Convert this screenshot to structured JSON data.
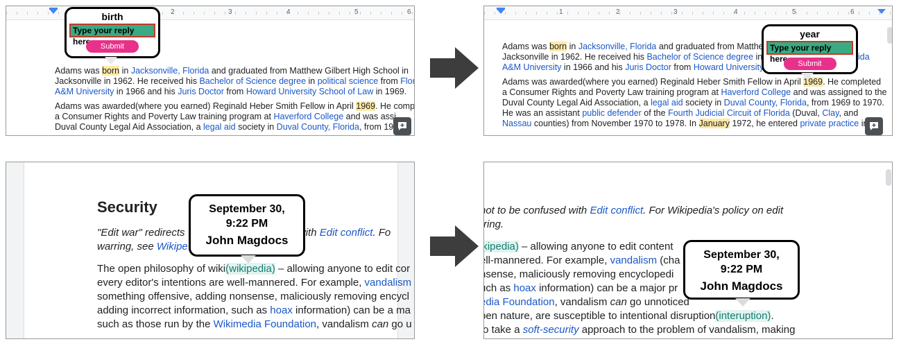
{
  "ruler": {
    "n1": "1",
    "n2": "2",
    "n3": "3",
    "n4": "4",
    "n5": "5",
    "n6": "6"
  },
  "panel1": {
    "popup": {
      "title": "birth",
      "input_placeholder": "Type your reply here..",
      "submit": "Submit"
    },
    "p1": {
      "l1": [
        "Adams was ",
        "born",
        " in ",
        "Jacksonville, Florida",
        " and graduated from Matthew Gilbert High School in"
      ],
      "l2": [
        "Jacksonville in 1962. He received his ",
        "Bachelor of Science degree",
        " in ",
        "political science",
        " from ",
        "Flori"
      ],
      "l3": [
        "A&M University",
        " in 1966 and his ",
        "Juris Doctor",
        " from ",
        "Howard University School of Law",
        " in 1969."
      ]
    },
    "p2": {
      "l1": [
        "Adams was awarded(where you earned) Reginald Heber Smith Fellow in April ",
        "1969",
        ". He compl"
      ],
      "l2": [
        "a Consumer Rights and Poverty Law training program at ",
        "Haverford College",
        " and was assi"
      ],
      "l3": [
        "Duval County Legal Aid Association, a ",
        "legal aid",
        " society in ",
        "Duval County, Florida",
        ", from 19"
      ]
    }
  },
  "panel2": {
    "popup": {
      "title": "year",
      "input_placeholder": "Type your reply here..",
      "submit": "Submit"
    },
    "p1": {
      "l1": [
        "Adams was ",
        "born",
        " in ",
        "Jacksonville, Florida",
        " and graduated from Matthe"
      ],
      "l2": [
        "Jacksonville in 1962. He received his ",
        "Bachelor of Science degree",
        " in"
      ],
      "l2b": "ida",
      "l3": [
        "A&M University",
        " in 1966 and his ",
        "Juris Doctor",
        " from ",
        "Howard University"
      ]
    },
    "p2": {
      "l1": [
        "Adams was awarded(where you earned) Reginald Heber Smith Fellow in April ",
        "1969",
        ". He completed"
      ],
      "l2": [
        "a Consumer Rights and Poverty Law training program at ",
        "Haverford College",
        " and was assigned to the"
      ],
      "l3": [
        "Duval County Legal Aid Association, a ",
        "legal aid",
        " society in ",
        "Duval County, Florida",
        ", from 1969 to 1970."
      ],
      "l4": [
        "He was an assistant ",
        "public defender",
        " of the ",
        "Fourth Judicial Circuit of Florida",
        " (Duval, ",
        "Clay",
        ", and"
      ],
      "l5": [
        "Nassau",
        " counties) from November 1970 to 1978. In ",
        "January",
        " 1972, he entered ",
        "private practice",
        " in"
      ]
    }
  },
  "panel3": {
    "heading": "Security",
    "callout": {
      "date_line1": "September 30,",
      "date_line2": "9:22 PM",
      "name": "John Magdocs"
    },
    "l1": [
      "\"Edit war\" redirects",
      "sed with ",
      "Edit conflict",
      ". Fo"
    ],
    "l2": [
      "warring, see ",
      "Wikipe"
    ],
    "l3": [
      "The open philosophy of wiki",
      "(wikipedia)",
      " – allowing anyone to edit cor"
    ],
    "l4": [
      "every editor's intentions are well-mannered. For example, ",
      "vandalism"
    ],
    "l5": "something offensive, adding nonsense, maliciously removing encycl",
    "l6": [
      "adding incorrect information, such as ",
      "hoax",
      " information) can be a ma"
    ],
    "l7": [
      "such as those run by the ",
      "Wikimedia Foundation",
      ", vandalism ",
      "can",
      " go u"
    ]
  },
  "panel4": {
    "callout": {
      "date_line1": "September 30,",
      "date_line2": "9:22 PM",
      "name": "John Magdocs"
    },
    "l1": [
      "not to be confused with ",
      "Edit conflict",
      ". For Wikipedia's policy on edit"
    ],
    "l2": "rring.",
    "l3": [
      "ikipedia)",
      " – allowing anyone to edit content"
    ],
    "l4": [
      "ell-mannered. For example, ",
      "vandalism",
      " (cha"
    ],
    "l5": "nsense, maliciously removing encyclopedi",
    "l6": [
      "uch as ",
      "hoax",
      " information) can be a major pr"
    ],
    "l6b": "s,",
    "l7": [
      "edia Foundation",
      ", vandalism ",
      "can",
      " go unnoticed"
    ],
    "l8": [
      "pen nature, are susceptible to intentional disruption",
      "(interuption)",
      "."
    ],
    "l9": [
      "to take a ",
      "soft-security",
      " approach to the problem of vandalism, making"
    ]
  },
  "colors": {
    "highlight_yellow": "#fde9a8",
    "link_blue": "#1a57c8",
    "reply_green": "#3aaa82",
    "submit_pink": "#e8318a",
    "comment_teal": "#157a6e",
    "arrow": "#3d3d3d",
    "ruler_marker": "#4285f4"
  },
  "icons": {
    "comment_button": "add-comment-icon",
    "flow_arrow": "right-arrow-icon"
  }
}
